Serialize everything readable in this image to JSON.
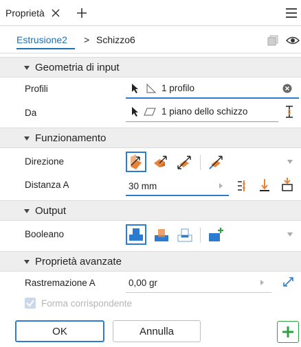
{
  "tab": {
    "label": "Proprietà"
  },
  "breadcrumb": {
    "parent": "Estrusione2",
    "separator": ">",
    "current": "Schizzo6"
  },
  "sections": {
    "input": {
      "title": "Geometria di input"
    },
    "behavior": {
      "title": "Funzionamento"
    },
    "output": {
      "title": "Output"
    },
    "advanced": {
      "title": "Proprietà avanzate"
    }
  },
  "rows": {
    "profiles": {
      "label": "Profili",
      "value": "1 profilo"
    },
    "from": {
      "label": "Da",
      "value": "1 piano dello schizzo"
    },
    "direction": {
      "label": "Direzione"
    },
    "distance": {
      "label": "Distanza A",
      "value": "30 mm"
    },
    "boolean": {
      "label": "Booleano"
    },
    "taper": {
      "label": "Rastremazione A",
      "value": "0,00 gr"
    },
    "match_shape": {
      "label": "Forma corrispondente",
      "checked": true,
      "disabled": true
    }
  },
  "buttons": {
    "ok": "OK",
    "cancel": "Annulla"
  },
  "colors": {
    "accent": "#1e6fb5",
    "selected_border": "#2b7bd0",
    "orange": "#e8833a",
    "green": "#2ea043",
    "section_bg": "#eeeeee"
  }
}
